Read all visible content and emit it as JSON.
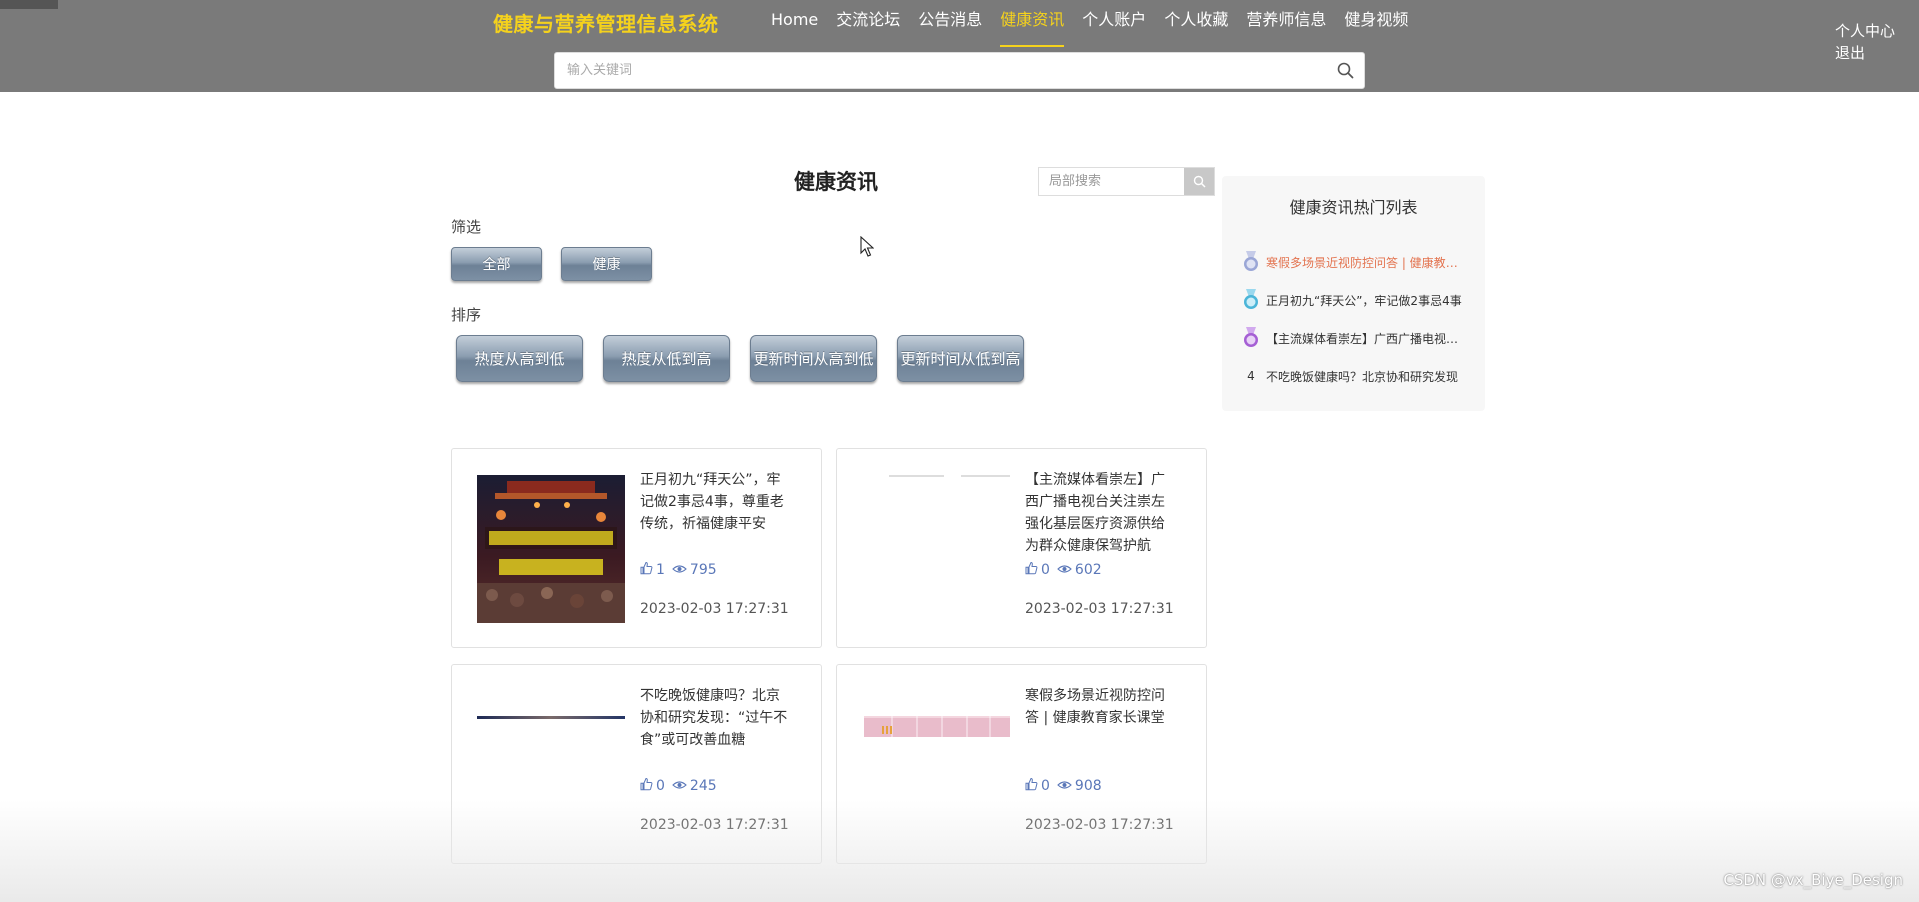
{
  "header": {
    "site_title": "健康与营养管理信息系统",
    "nav": [
      {
        "label": "Home",
        "active": false
      },
      {
        "label": "交流论坛",
        "active": false
      },
      {
        "label": "公告消息",
        "active": false
      },
      {
        "label": "健康资讯",
        "active": true
      },
      {
        "label": "个人账户",
        "active": false
      },
      {
        "label": "个人收藏",
        "active": false
      },
      {
        "label": "营养师信息",
        "active": false
      },
      {
        "label": "健身视频",
        "active": false
      }
    ],
    "user_links": {
      "profile": "个人中心",
      "logout": "退出"
    },
    "search_placeholder": "输入关键词",
    "colors": {
      "bar": "#7a7a7a",
      "accent": "#f5d21c"
    }
  },
  "main": {
    "page_title": "健康资讯",
    "local_search_placeholder": "局部搜索",
    "filter": {
      "label": "筛选",
      "options": [
        "全部",
        "健康"
      ]
    },
    "sort": {
      "label": "排序",
      "options": [
        "热度从高到低",
        "热度从低到高",
        "更新时间从高到低",
        "更新时间从低到高"
      ]
    },
    "cards": [
      {
        "title": "正月初九“拜天公”，牢记做2事忌4事，尊重老传统，祈福健康平安",
        "likes": "1",
        "views": "795",
        "date": "2023-02-03 17:27:31"
      },
      {
        "title": "【主流媒体看崇左】广西广播电视台关注崇左强化基层医疗资源供给为群众健康保驾护航",
        "likes": "0",
        "views": "602",
        "date": "2023-02-03 17:27:31"
      },
      {
        "title": "不吃晚饭健康吗？北京协和研究发现：“过午不食”或可改善血糖",
        "likes": "0",
        "views": "245",
        "date": "2023-02-03 17:27:31"
      },
      {
        "title": "寒假多场景近视防控问答 | 健康教育家长课堂",
        "likes": "0",
        "views": "908",
        "date": "2023-02-03 17:27:31"
      }
    ]
  },
  "hotlist": {
    "title": "健康资讯热门列表",
    "items": [
      {
        "text": "寒假多场景近视防控问答 | 健康教育家长课堂",
        "rank": "1",
        "color": "#9aa6d6"
      },
      {
        "text": "正月初九“拜天公”，牢记做2事忌4事",
        "rank": "2",
        "color": "#4bb5d8"
      },
      {
        "text": "【主流媒体看崇左】广西广播电视台关注崇左",
        "rank": "3",
        "color": "#a55fd4"
      },
      {
        "text": "不吃晚饭健康吗？北京协和研究发现",
        "rank": "4",
        "color": ""
      }
    ]
  },
  "watermark": "CSDN @vx_Biye_Design"
}
